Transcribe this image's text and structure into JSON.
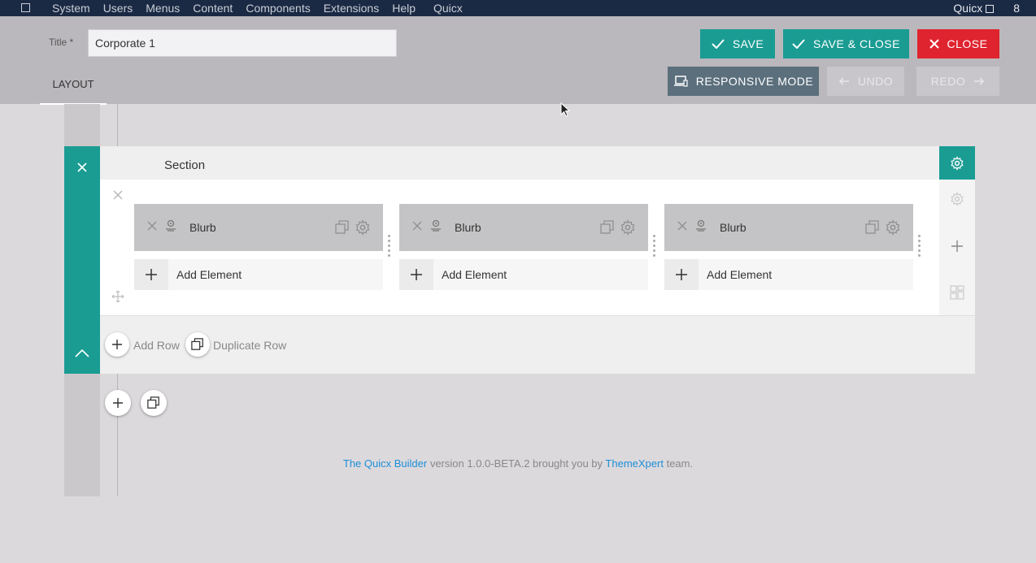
{
  "topbar": {
    "menu": [
      "System",
      "Users",
      "Menus",
      "Content",
      "Components",
      "Extensions",
      "Help",
      "Quicx"
    ],
    "site_name": "Quicx",
    "count": "8"
  },
  "header": {
    "title_label": "Title *",
    "title_value": "Corporate 1",
    "tab_layout": "LAYOUT",
    "save": "SAVE",
    "save_close": "SAVE & CLOSE",
    "close": "CLOSE",
    "responsive": "RESPONSIVE MODE",
    "undo": "UNDO",
    "redo": "REDO"
  },
  "section": {
    "title": "Section",
    "columns": [
      {
        "element": "Blurb",
        "add_label": "Add Element"
      },
      {
        "element": "Blurb",
        "add_label": "Add Element"
      },
      {
        "element": "Blurb",
        "add_label": "Add Element"
      }
    ],
    "add_row": "Add Row",
    "duplicate_row": "Duplicate Row"
  },
  "credit": {
    "link1": "The Quicx Builder",
    "mid": " version 1.0.0-BETA.2 brought you by ",
    "link2": "ThemeXpert",
    "end": " team."
  },
  "colors": {
    "accent": "#1a9c93",
    "danger": "#e0242f",
    "topbar": "#1b2a44",
    "link": "#1d8fd6"
  }
}
